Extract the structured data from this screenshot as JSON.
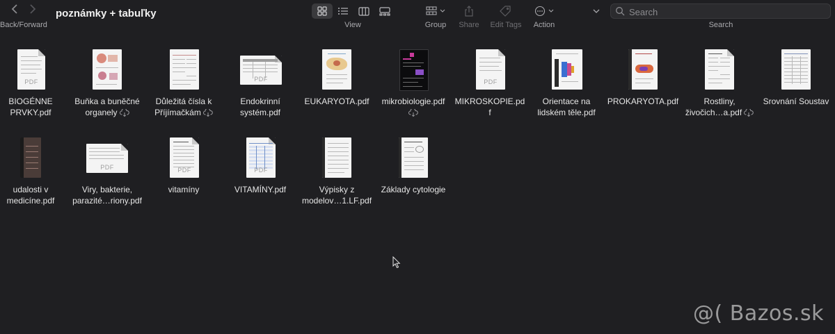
{
  "toolbar": {
    "back_icon": "chevron-left",
    "forward_icon": "chevron-right",
    "nav_label": "Back/Forward",
    "folder_title": "poznámky + tabuľky",
    "view_label": "View",
    "group_label": "Group",
    "share_label": "Share",
    "edit_tags_label": "Edit Tags",
    "action_label": "Action",
    "search_label": "Search",
    "search_placeholder": "Search"
  },
  "files": [
    {
      "name": "BIOGÉNNE PRVKY.pdf",
      "line1": "BIOGÉNNE",
      "line2": "PRVKY.pdf",
      "cloud": false
    },
    {
      "name": "Buňka a buněčné organely",
      "line1": "Buňka a buněčné",
      "line2": "organely",
      "cloud": true
    },
    {
      "name": "Důležitá čísla k Příjímačkám",
      "line1": "Důležitá čísla k",
      "line2": "Příjímačkám",
      "cloud": true
    },
    {
      "name": "Endokrinní systém.pdf",
      "line1": "Endokrinní",
      "line2": "systém.pdf",
      "cloud": false
    },
    {
      "name": "EUKARYOTA.pdf",
      "line1": "EUKARYOTA.pdf",
      "line2": "",
      "cloud": false
    },
    {
      "name": "mikrobiologie.pdf",
      "line1": "mikrobiologie.pdf",
      "line2": "",
      "cloud": true
    },
    {
      "name": "MIKROSKOPIE.pdf",
      "line1": "MIKROSKOPIE.pd",
      "line2": "f",
      "cloud": false
    },
    {
      "name": "Orientace na lidském těle.pdf",
      "line1": "Orientace na",
      "line2": "lidském těle.pdf",
      "cloud": false
    },
    {
      "name": "PROKARYOTA.pdf",
      "line1": "PROKARYOTA.pdf",
      "line2": "",
      "cloud": false
    },
    {
      "name": "Rostliny, živočich...a.pdf",
      "line1": "Rostliny,",
      "line2": "živočich…a.pdf",
      "cloud": true
    },
    {
      "name": "Srovnání Soustav",
      "line1": "Srovnání Soustav",
      "line2": "",
      "cloud": false
    },
    {
      "name": "udalosti v medicíne.pdf",
      "line1": "udalosti v",
      "line2": "medicíne.pdf",
      "cloud": false
    },
    {
      "name": "Viry, bakterie, parazité...riony.pdf",
      "line1": "Viry, bakterie,",
      "line2": "parazité…riony.pdf",
      "cloud": false
    },
    {
      "name": "vitamíny",
      "line1": "vitamíny",
      "line2": "",
      "cloud": false
    },
    {
      "name": "VITAMÍNY.pdf",
      "line1": "VITAMÍNY.pdf",
      "line2": "",
      "cloud": false
    },
    {
      "name": "Výpisky z modelov...1.LF.pdf",
      "line1": "Výpisky z",
      "line2": "modelov…1.LF.pdf",
      "cloud": false
    },
    {
      "name": "Základy cytologie",
      "line1": "Základy cytologie",
      "line2": "",
      "cloud": false
    }
  ],
  "thumb_tags": {
    "pdf": "PDF"
  },
  "watermark": "@( Bazos.sk",
  "colors": {
    "background": "#1f1f22",
    "text": "#e6e6e6",
    "label": "#a9a9ad"
  }
}
